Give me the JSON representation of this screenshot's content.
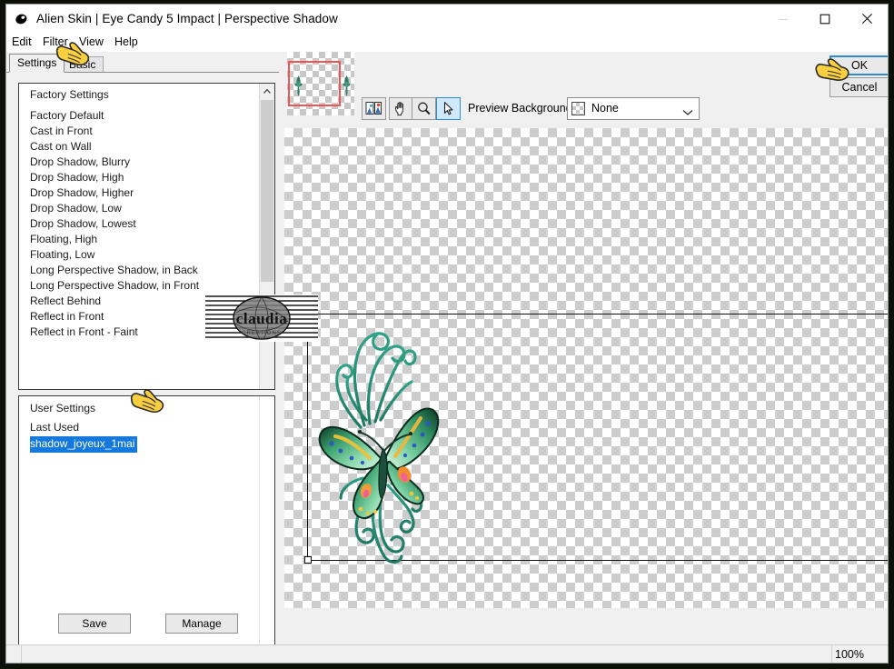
{
  "window": {
    "title": "Alien Skin | Eye Candy 5 Impact | Perspective Shadow",
    "app_icon": "alien-skin-logo-icon",
    "minimize_label": "",
    "maximize_label": "",
    "close_label": ""
  },
  "menu": {
    "items": [
      {
        "label": "Edit"
      },
      {
        "label": "Filter"
      },
      {
        "label": "View"
      },
      {
        "label": "Help"
      }
    ]
  },
  "tabs": [
    {
      "label": "Settings",
      "active": true
    },
    {
      "label": "Basic",
      "active": false
    }
  ],
  "factory_settings": {
    "group_label": "Factory Settings",
    "items": [
      "Factory Default",
      "Cast in Front",
      "Cast on Wall",
      "Drop Shadow, Blurry",
      "Drop Shadow, High",
      "Drop Shadow, Higher",
      "Drop Shadow, Low",
      "Drop Shadow, Lowest",
      "Floating, High",
      "Floating, Low",
      "Long Perspective Shadow, in Back",
      "Long Perspective Shadow, in Front",
      "Reflect Behind",
      "Reflect in Front",
      "Reflect in Front - Faint"
    ]
  },
  "user_settings": {
    "group_label": "User Settings",
    "subgroup_label": "Last Used",
    "items": [
      {
        "label": "shadow_joyeux_1mai",
        "selected": true
      }
    ]
  },
  "panel_buttons": {
    "save_label": "Save",
    "manage_label": "Manage"
  },
  "toolbar": {
    "tools": [
      {
        "name": "compare-view-icon",
        "selected": false
      },
      {
        "name": "hand-pan-icon",
        "selected": false
      },
      {
        "name": "zoom-magnifier-icon",
        "selected": false
      },
      {
        "name": "arrow-select-icon",
        "selected": true
      }
    ],
    "preview_background_label": "Preview Background:",
    "preview_background_value": "None",
    "preview_background_options": [
      "None"
    ]
  },
  "dialog_buttons": {
    "ok_label": "OK",
    "cancel_label": "Cancel"
  },
  "status_bar": {
    "zoom_level": "100%"
  },
  "preview": {
    "image_name": "green-butterfly-filigree",
    "watermark_text": "claudia",
    "transparency_checker": true
  },
  "colors": {
    "accent_blue": "#2f8ad4",
    "selection_blue": "#1478dc",
    "nav_rect_red": "#f2534f",
    "panel_bg": "#f0f0f0",
    "cursor_yellow": "#f6c430"
  }
}
